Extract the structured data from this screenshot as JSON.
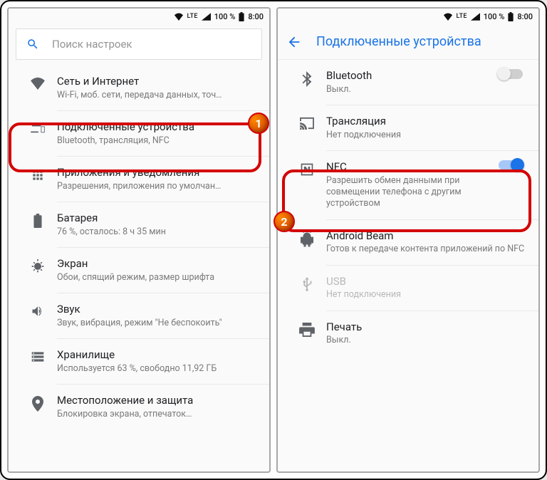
{
  "status": {
    "battery": "100 %",
    "time": "8:00",
    "net": "LTE"
  },
  "left": {
    "search_placeholder": "Поиск настроек",
    "items": [
      {
        "title": "Сеть и Интернет",
        "sub": "Wi-Fi, моб. сети, передача данных, точ…"
      },
      {
        "title": "Подключенные устройства",
        "sub": "Bluetooth, трансляция, NFC"
      },
      {
        "title": "Приложения и уведомления",
        "sub": "Разрешения, приложения по умолчан…"
      },
      {
        "title": "Батарея",
        "sub": "76 %, осталось: 8 ч 35 мин"
      },
      {
        "title": "Экран",
        "sub": "Обои, спящий режим, размер шрифта"
      },
      {
        "title": "Звук",
        "sub": "Звук, вибрация, режим \"Не беспокоить\""
      },
      {
        "title": "Хранилище",
        "sub": "Используется 63 %, свободно 11,92 ГБ"
      },
      {
        "title": "Местоположение и защита",
        "sub": "Блокировка экрана, отпечаток…"
      }
    ]
  },
  "right": {
    "header": "Подключенные устройства",
    "items": [
      {
        "title": "Bluetooth",
        "sub": "Выкл.",
        "toggle": "off"
      },
      {
        "title": "Трансляция",
        "sub": "Нет подключения"
      },
      {
        "title": "NFC",
        "sub": "Разрешить обмен данными при совмещении телефона с другим устройством",
        "toggle": "on"
      },
      {
        "title": "Android Beam",
        "sub": "Готов к передаче контента приложений по NFC"
      },
      {
        "title": "USB",
        "sub": "Нет подключения",
        "muted": true
      },
      {
        "title": "Печать",
        "sub": "Выкл."
      }
    ]
  },
  "badges": {
    "one": "1",
    "two": "2"
  }
}
